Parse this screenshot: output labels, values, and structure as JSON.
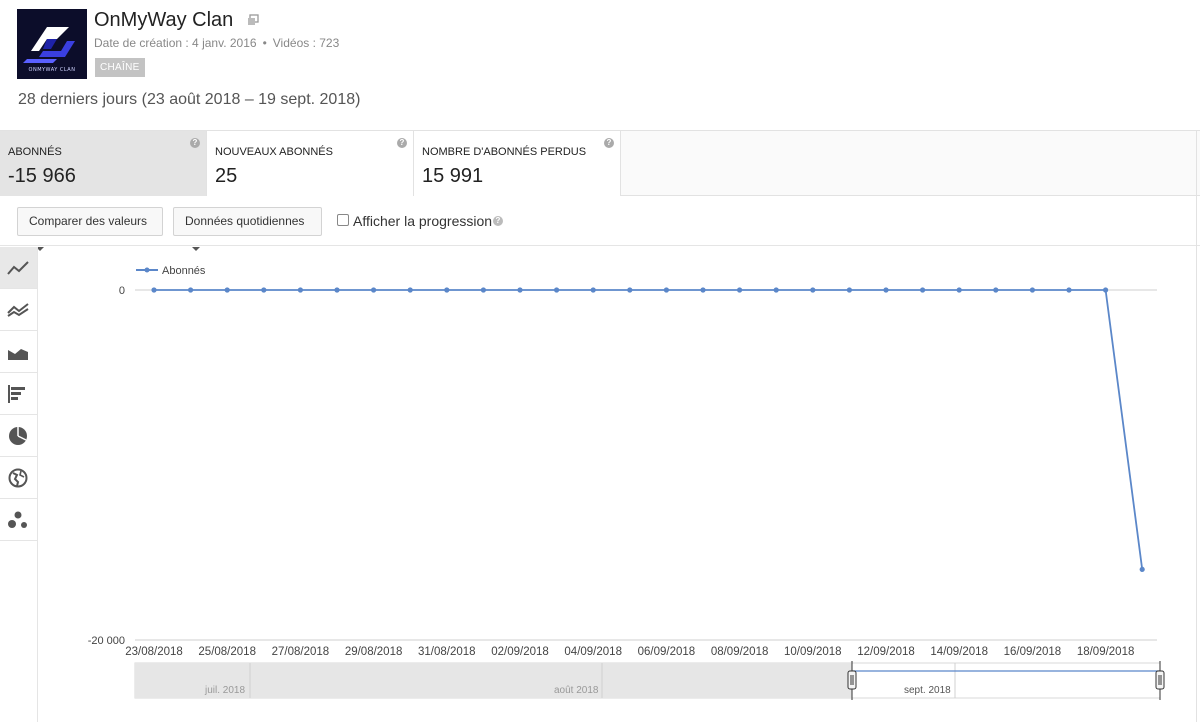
{
  "channel": {
    "name": "OnMyWay Clan",
    "logo_text": "ONMYWAY CLAN",
    "created_label": "Date de création : 4 janv. 2016",
    "videos_label": "Vidéos : 723",
    "badge": "CHAÎNE",
    "icon": "external-window-icon"
  },
  "period": "28 derniers jours (23 août 2018 – 19 sept. 2018)",
  "metrics": [
    {
      "label": "ABONNÉS",
      "value": "-15 966",
      "active": true
    },
    {
      "label": "NOUVEAUX ABONNÉS",
      "value": "25",
      "active": false
    },
    {
      "label": "NOMBRE D'ABONNÉS PERDUS",
      "value": "15 991",
      "active": false
    }
  ],
  "controls": {
    "compare": "Comparer des valeurs",
    "granularity": "Données quotidiennes",
    "show_progress": "Afficher la progression",
    "show_progress_checked": false
  },
  "toolbar": [
    "line-chart-icon",
    "multi-line-chart-icon",
    "stacked-area-chart-icon",
    "bar-chart-icon",
    "pie-chart-icon",
    "globe-map-icon",
    "bubble-chart-icon"
  ],
  "colors": {
    "series": "#5b87c9",
    "active_card": "#e4e4e4",
    "badge": "#c3c3c3",
    "navigator_fill": "#e6e6e6"
  },
  "chart_data": {
    "type": "line",
    "legend": "Abonnés",
    "legend_position": "top-left",
    "y_ticks": [
      "0",
      "-20 000"
    ],
    "ylim": [
      -20000,
      0
    ],
    "x_tick_labels": [
      "23/08/2018",
      "25/08/2018",
      "27/08/2018",
      "29/08/2018",
      "31/08/2018",
      "02/09/2018",
      "04/09/2018",
      "06/09/2018",
      "08/09/2018",
      "10/09/2018",
      "12/09/2018",
      "14/09/2018",
      "16/09/2018",
      "18/09/2018"
    ],
    "x": [
      "23/08/2018",
      "24/08/2018",
      "25/08/2018",
      "26/08/2018",
      "27/08/2018",
      "28/08/2018",
      "29/08/2018",
      "30/08/2018",
      "31/08/2018",
      "01/09/2018",
      "02/09/2018",
      "03/09/2018",
      "04/09/2018",
      "05/09/2018",
      "06/09/2018",
      "07/09/2018",
      "08/09/2018",
      "09/09/2018",
      "10/09/2018",
      "11/09/2018",
      "12/09/2018",
      "13/09/2018",
      "14/09/2018",
      "15/09/2018",
      "16/09/2018",
      "17/09/2018",
      "18/09/2018",
      "19/09/2018"
    ],
    "series": [
      {
        "name": "Abonnés",
        "values": [
          0,
          0,
          0,
          0,
          0,
          0,
          0,
          0,
          0,
          0,
          0,
          0,
          0,
          0,
          0,
          0,
          0,
          0,
          0,
          0,
          0,
          0,
          0,
          0,
          0,
          0,
          0,
          -15966
        ]
      }
    ],
    "navigator_labels": [
      "juil. 2018",
      "août 2018",
      "sept. 2018"
    ],
    "grid": false
  }
}
